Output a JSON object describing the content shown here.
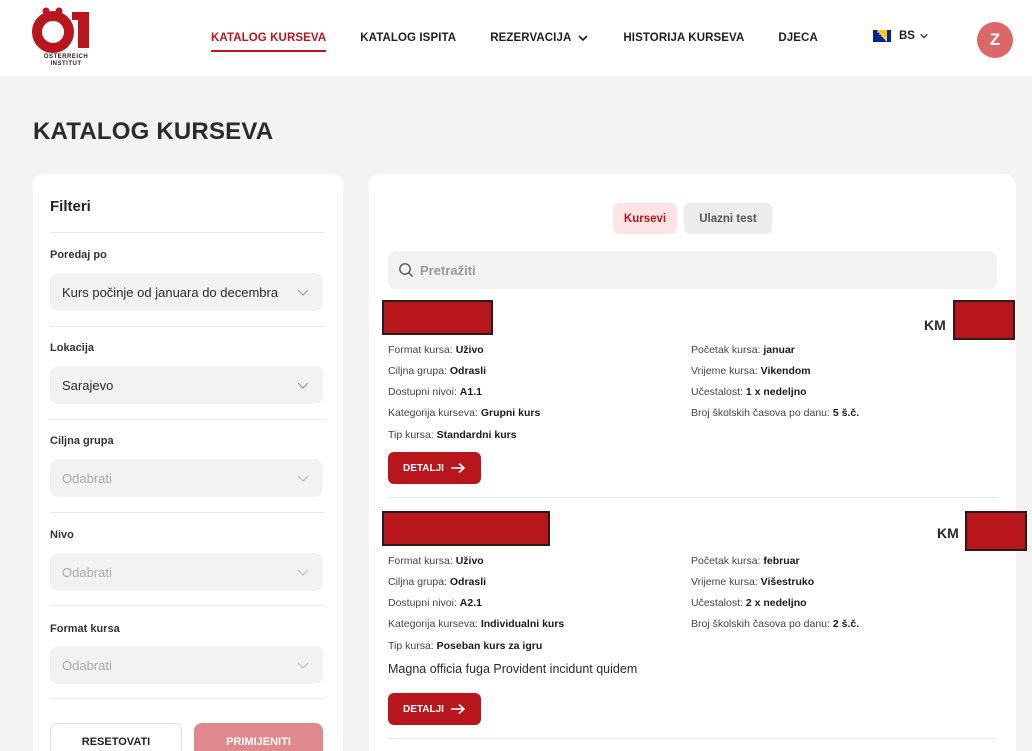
{
  "brand": {
    "logo_mark": "ÖI",
    "logo_line1": "ÖSTERREICH",
    "logo_line2": "INSTITUT",
    "accent": "#b8161d"
  },
  "nav": {
    "items": [
      {
        "label": "KATALOG KURSEVA",
        "active": true
      },
      {
        "label": "KATALOG ISPITA",
        "active": false
      },
      {
        "label": "REZERVACIJA",
        "active": false,
        "dropdown": true
      },
      {
        "label": "HISTORIJA KURSEVA",
        "active": false
      },
      {
        "label": "DJECA",
        "active": false
      }
    ],
    "language": "BS",
    "avatar_initial": "Z"
  },
  "page": {
    "title": "KATALOG KURSEVA"
  },
  "filters": {
    "title": "Filteri",
    "sort": {
      "label": "Poredaj po",
      "value": "Kurs počinje od januara do decembra"
    },
    "location": {
      "label": "Lokacija",
      "value": "Sarajevo"
    },
    "target_group": {
      "label": "Ciljna grupa",
      "placeholder": "Odabrati"
    },
    "level": {
      "label": "Nivo",
      "placeholder": "Odabrati"
    },
    "course_format": {
      "label": "Format kursa",
      "placeholder": "Odabrati"
    },
    "reset_label": "RESETOVATI",
    "apply_label": "PRIMIJENITI"
  },
  "tabs": {
    "courses": "Kursevi",
    "entry_test": "Ulazni test"
  },
  "search": {
    "placeholder": "Pretražiti"
  },
  "currency": "KM",
  "labels": {
    "format": "Format kursa:",
    "target": "Ciljna grupa:",
    "levels": "Dostupni nivoi:",
    "category": "Kategorija kurseva:",
    "type": "Tip kursa:",
    "start": "Početak kursa:",
    "time": "Vrijeme kursa:",
    "frequency": "Učestalost:",
    "hours": "Broj školskih časova po danu:"
  },
  "details_label": "DETALJI",
  "courses": [
    {
      "format": "Uživo",
      "target": "Odrasli",
      "levels": "A1.1",
      "category": "Grupni kurs",
      "type": "Standardni kurs",
      "start": "januar",
      "time": "Vikendom",
      "frequency": "1 x nedeljno",
      "hours": "5 š.č.",
      "description": ""
    },
    {
      "format": "Uživo",
      "target": "Odrasli",
      "levels": "A2.1",
      "category": "Individualni kurs",
      "type": "Poseban kurs za igru",
      "start": "februar",
      "time": "Višestruko",
      "frequency": "2 x nedeljno",
      "hours": "2 š.č.",
      "description": "Magna officia fuga Provident incidunt quidem"
    }
  ]
}
